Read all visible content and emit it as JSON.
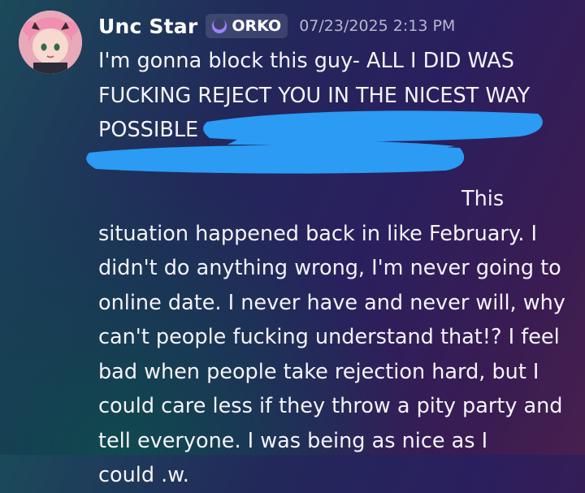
{
  "message": {
    "username": "Unc Star",
    "tag": {
      "text": "ORKO",
      "icon": "moon-icon"
    },
    "timestamp": "07/23/2025 2:13 PM",
    "lines": [
      "I'm gonna block this guy- ALL I DID WAS",
      "FUCKING REJECT YOU IN THE NICEST WAY",
      "POSSIBLE",
      "",
      "This",
      "situation happened back in like February. I",
      "didn't do anything wrong, I'm never going to",
      "online date. I never have and never will, why",
      "can't people fucking understand that!? I feel",
      "bad when people take rejection hard, but I",
      "could care less if they throw a pity party and",
      "tell everyone. I was being as nice as I",
      "could .w."
    ],
    "redaction_color": "#2b9bf4"
  },
  "colors": {
    "username": "#ffffff",
    "timestamp": "#b9b6cf",
    "tag_background": "#3a3f66",
    "tag_icon": "#9b84ff"
  }
}
